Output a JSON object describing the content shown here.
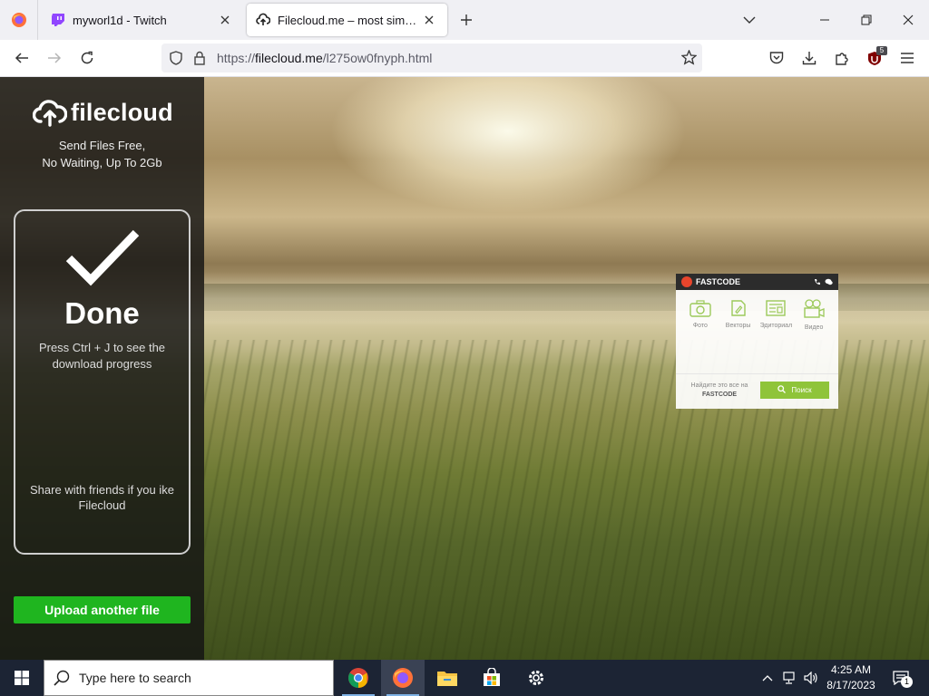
{
  "browser": {
    "tabs": [
      {
        "title": "myworl1d - Twitch",
        "active": false
      },
      {
        "title": "Filecloud.me – most simple file",
        "active": true
      }
    ],
    "url": {
      "prefix": "https://",
      "domain": "filecloud.me",
      "path": "/l275ow0fnyph.html"
    },
    "extension_badge": "5"
  },
  "sidebar": {
    "logo_text": "filecloud",
    "tagline_line1": "Send Files Free,",
    "tagline_line2": "No Waiting, Up To 2Gb",
    "done_title": "Done",
    "done_sub_line1": "Press Ctrl + J to see the",
    "done_sub_line2": "download progress",
    "share_line1": "Share with friends if you ike",
    "share_line2": "Filecloud",
    "upload_button": "Upload another file"
  },
  "ad": {
    "brand": "FASTCODE",
    "icons": [
      {
        "label": "Фото",
        "icon": "camera-icon"
      },
      {
        "label": "Векторы",
        "icon": "vector-icon"
      },
      {
        "label": "Эдиториал",
        "icon": "editorial-icon"
      },
      {
        "label": "Видео",
        "icon": "video-icon"
      }
    ],
    "footer_text": "Найдите это все на",
    "footer_brand": "FASTCODE",
    "search_button": "Поиск"
  },
  "taskbar": {
    "search_placeholder": "Type here to search",
    "apps": [
      "chrome-icon",
      "firefox-icon",
      "file-explorer-icon",
      "store-icon",
      "settings-icon"
    ],
    "time": "4:25 AM",
    "date": "8/17/2023",
    "notification_count": "1"
  },
  "colors": {
    "upload_button": "#1fb51f",
    "ad_button": "#8fc43a",
    "taskbar": "#1c2434",
    "tabstrip": "#f0f0f4"
  }
}
